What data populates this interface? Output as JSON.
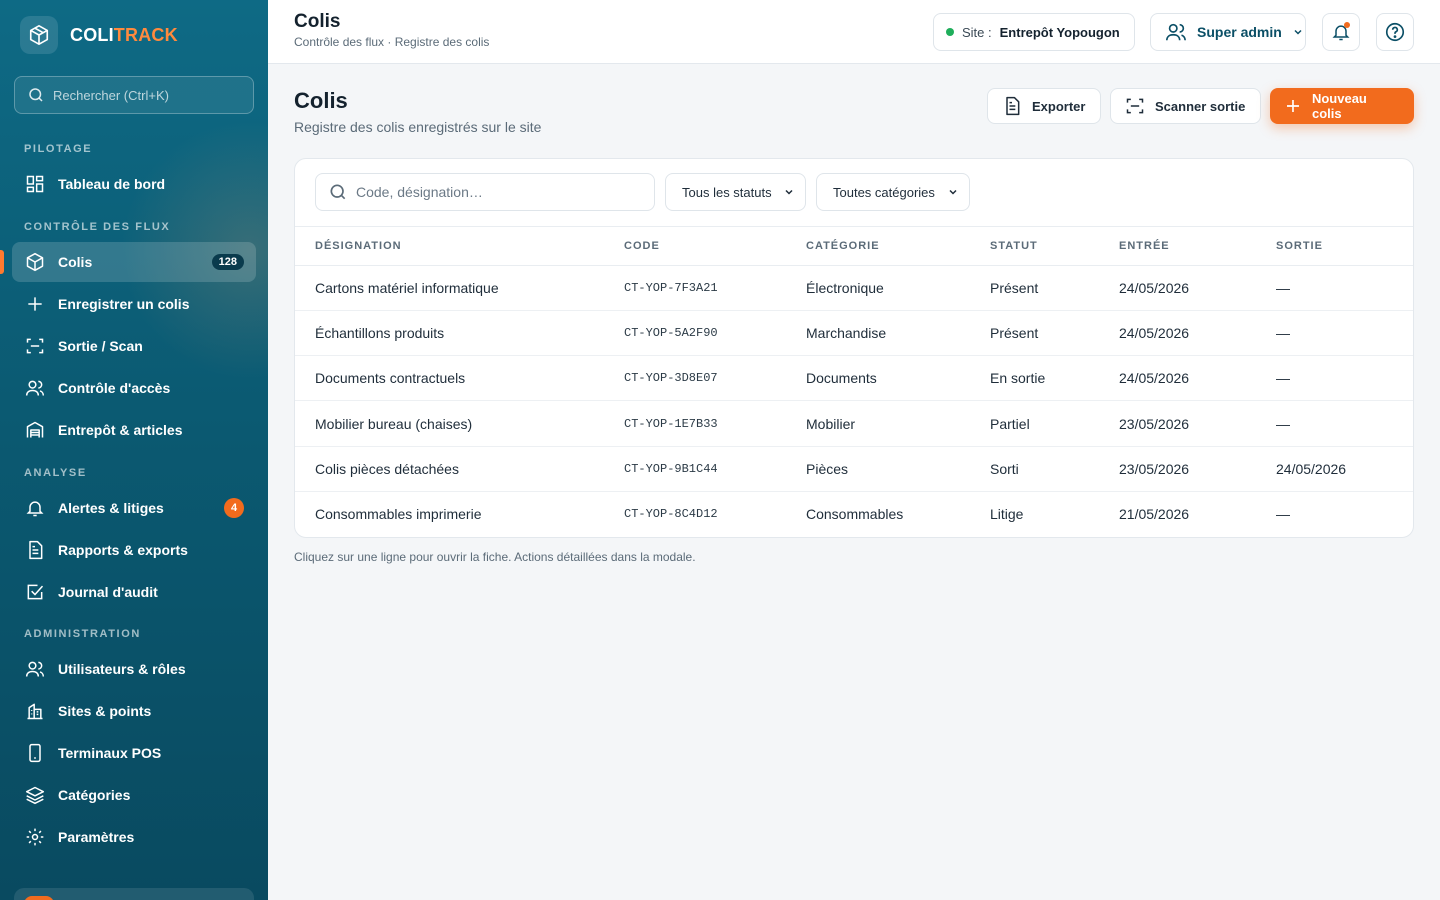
{
  "brand": {
    "name_part1": "COLI",
    "name_part2": "TRACK"
  },
  "sidebar": {
    "search_placeholder": "Rechercher (Ctrl+K)",
    "sections": {
      "pilotage": "PILOTAGE",
      "controle": "CONTRÔLE DES FLUX",
      "analyse": "ANALYSE",
      "administration": "ADMINISTRATION"
    },
    "items": {
      "dashboard": "Tableau de bord",
      "colis": "Colis",
      "colis_badge": "128",
      "enregistrer": "Enregistrer un colis",
      "sortie": "Sortie / Scan",
      "acces": "Contrôle d'accès",
      "entrepot": "Entrepôt & articles",
      "alertes": "Alertes & litiges",
      "alertes_badge": "4",
      "rapports": "Rapports & exports",
      "journal": "Journal d'audit",
      "utilisateurs": "Utilisateurs & rôles",
      "sites": "Sites & points",
      "terminaux": "Terminaux POS",
      "categories": "Catégories",
      "parametres": "Paramètres"
    }
  },
  "topbar": {
    "title": "Colis",
    "breadcrumb": "Contrôle des flux · Registre des colis",
    "site_label": "Site :",
    "site_value": "Entrepôt Yopougon",
    "user_label": "Super admin"
  },
  "main": {
    "title": "Colis",
    "subtitle": "Registre des colis enregistrés sur le site",
    "export_label": "Exporter",
    "scan_label": "Scanner sortie",
    "new_label": "Nouveau colis",
    "filter_placeholder": "Code, désignation…",
    "status_filter": "Tous les statuts",
    "category_filter": "Toutes catégories",
    "columns": {
      "designation": "DÉSIGNATION",
      "code": "CODE",
      "categorie": "CATÉGORIE",
      "statut": "STATUT",
      "entree": "ENTRÉE",
      "sortie": "SORTIE"
    },
    "rows": [
      {
        "designation": "Cartons matériel informatique",
        "code": "CT-YOP-7F3A21",
        "categorie": "Électronique",
        "statut": "Présent",
        "entree": "24/05/2026",
        "sortie": "—"
      },
      {
        "designation": "Échantillons produits",
        "code": "CT-YOP-5A2F90",
        "categorie": "Marchandise",
        "statut": "Présent",
        "entree": "24/05/2026",
        "sortie": "—"
      },
      {
        "designation": "Documents contractuels",
        "code": "CT-YOP-3D8E07",
        "categorie": "Documents",
        "statut": "En sortie",
        "entree": "24/05/2026",
        "sortie": "—"
      },
      {
        "designation": "Mobilier bureau (chaises)",
        "code": "CT-YOP-1E7B33",
        "categorie": "Mobilier",
        "statut": "Partiel",
        "entree": "23/05/2026",
        "sortie": "—"
      },
      {
        "designation": "Colis pièces détachées",
        "code": "CT-YOP-9B1C44",
        "categorie": "Pièces",
        "statut": "Sorti",
        "entree": "23/05/2026",
        "sortie": "24/05/2026"
      },
      {
        "designation": "Consommables imprimerie",
        "code": "CT-YOP-8C4D12",
        "categorie": "Consommables",
        "statut": "Litige",
        "entree": "21/05/2026",
        "sortie": "—"
      }
    ],
    "footnote": "Cliquez sur une ligne pour ouvrir la fiche. Actions détaillées dans la modale."
  },
  "colors": {
    "brand_teal": "#0e6a85",
    "accent_orange": "#f26b1d",
    "success_green": "#1fae5b"
  }
}
